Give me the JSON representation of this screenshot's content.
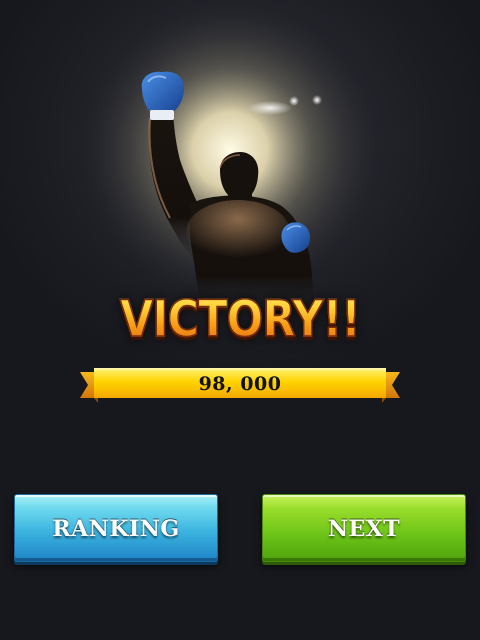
{
  "result": {
    "title": "VICTORY!!",
    "score": "98, 000"
  },
  "buttons": {
    "ranking_label": "RANKING",
    "next_label": "NEXT"
  },
  "colors": {
    "background": "#1c1d23",
    "title_gold": "#f5a51e",
    "ribbon_yellow": "#ffd000",
    "ranking_blue": "#3bb4e0",
    "next_green": "#6cc418"
  }
}
